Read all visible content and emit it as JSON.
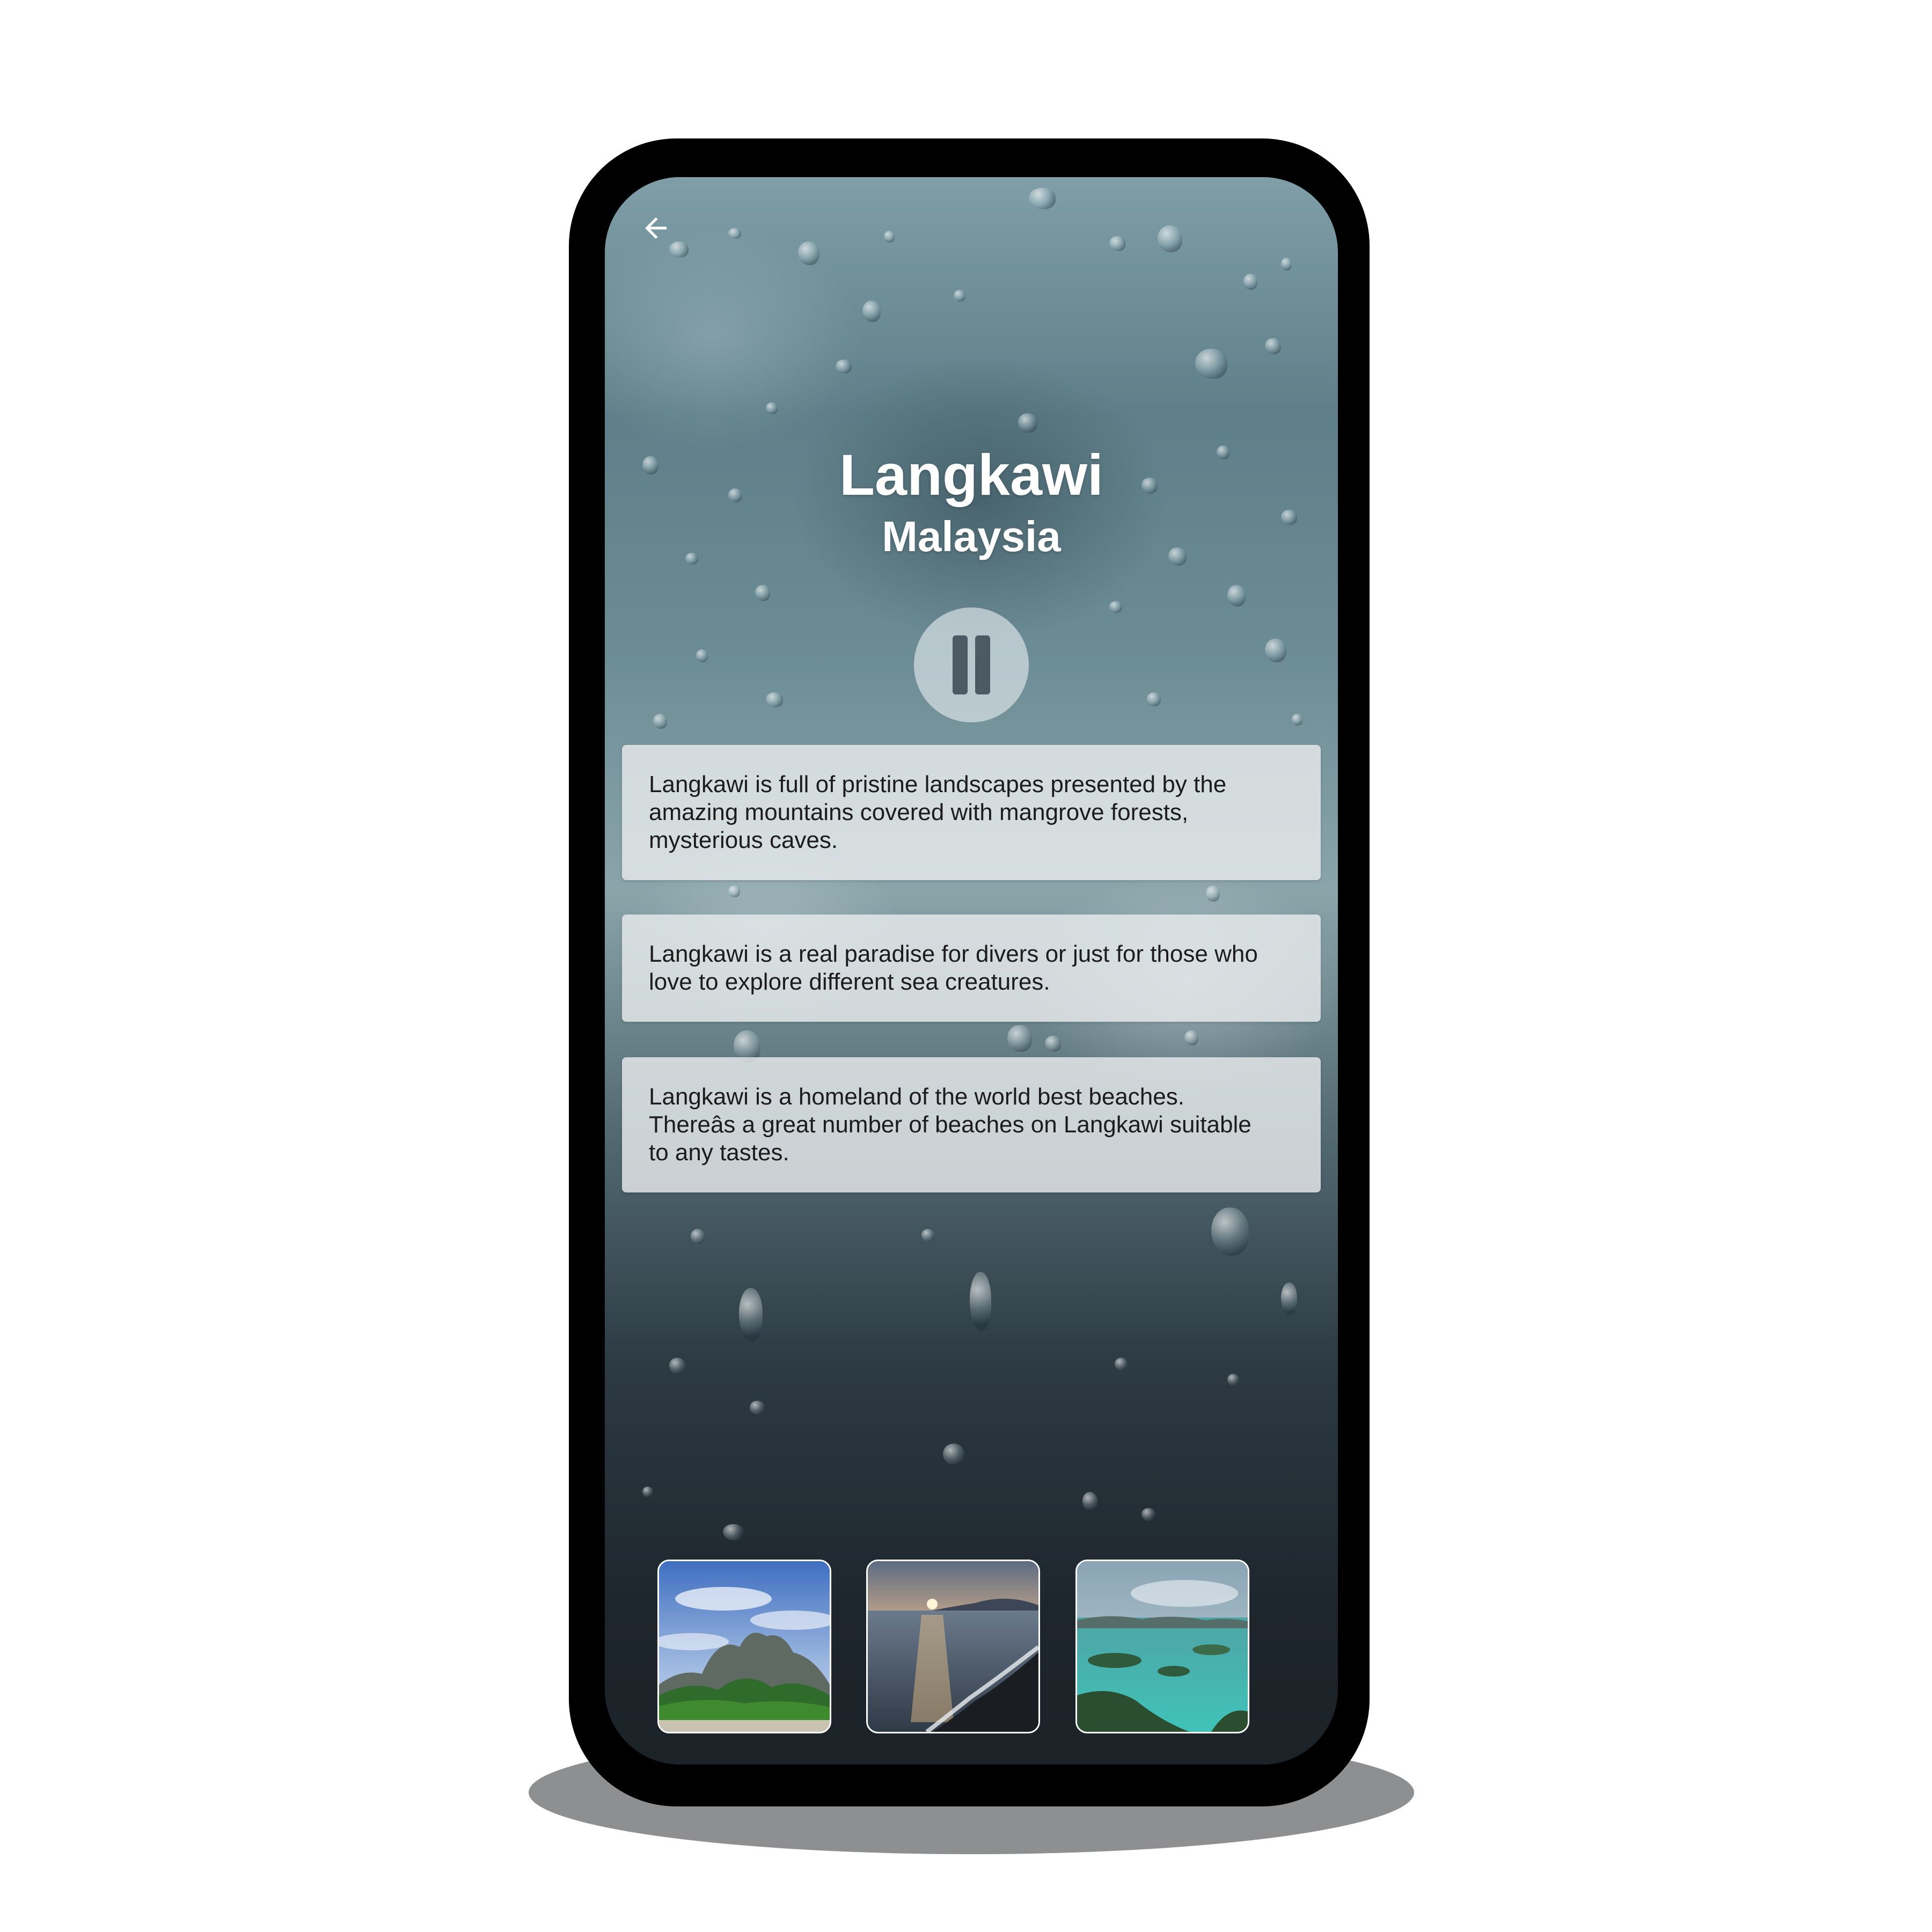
{
  "header": {
    "back_icon": "arrow-left-icon"
  },
  "destination": {
    "name": "Langkawi",
    "country": "Malaysia"
  },
  "player": {
    "state": "playing",
    "icon": "pause-icon"
  },
  "facts": [
    {
      "line1": "Langkawi is full of pristine landscapes presented by the",
      "line2": "amazing mountains covered with mangrove forests,",
      "line3": "mysterious caves."
    },
    {
      "line1": "Langkawi is a real paradise for divers or just for those who",
      "line2": "love to explore different sea creatures."
    },
    {
      "line1": "Langkawi is a homeland of the world best beaches.",
      "line2": "Thereâs a great number of beaches on Langkawi suitable",
      "line3": "to any tastes."
    }
  ],
  "gallery": [
    {
      "subject": "mountain-forest-photo"
    },
    {
      "subject": "beach-sunset-photo"
    },
    {
      "subject": "island-lagoon-photo"
    }
  ],
  "colors": {
    "text_light": "#ffffff",
    "card_text": "#1c1c1c",
    "frame": "#000000"
  }
}
